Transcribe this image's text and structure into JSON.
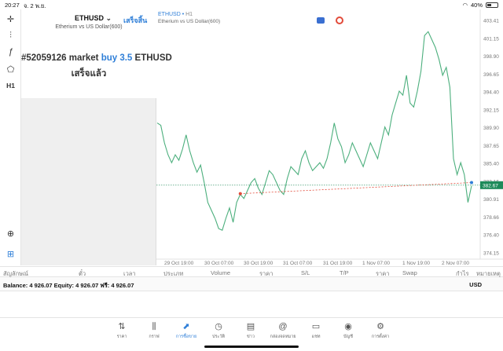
{
  "status": {
    "time": "20:27",
    "date": "จ. 2 พ.ย.",
    "battery": "40%"
  },
  "panel": {
    "symbol": "ETHUSD",
    "done_label": "เสร็จสิ้น",
    "description": "Etherium vs US Dollar(600)",
    "order_prefix": "#52059126 market",
    "order_action": "buy 3.5",
    "order_symbol": "ETHUSD",
    "order_status": "เสร็จแล้ว"
  },
  "chart_header": {
    "symbol": "ETHUSD",
    "timeframe": "H1",
    "subtitle": "Etherium vs US Dollar(600)"
  },
  "left_tools": {
    "timeframe": "H1"
  },
  "chart_data": {
    "type": "line",
    "y_ticks": [
      "403.41",
      "401.15",
      "398.90",
      "396.65",
      "394.40",
      "392.15",
      "389.90",
      "387.65",
      "385.40",
      "383.16",
      "380.91",
      "378.66",
      "376.40",
      "374.15"
    ],
    "x_labels": [
      "29 Oct 19:00",
      "30 Oct 07:00",
      "30 Oct 19:00",
      "31 Oct 07:00",
      "31 Oct 19:00",
      "1 Nov 07:00",
      "1 Nov 19:00",
      "2 Nov 07:00"
    ],
    "current_price": "382.67",
    "ylim": [
      374.15,
      403.41
    ],
    "values": [
      390.5,
      390.2,
      388.0,
      386.5,
      385.5,
      386.5,
      385.8,
      387.2,
      389.0,
      387.0,
      385.5,
      384.3,
      385.2,
      383.0,
      380.5,
      379.5,
      378.5,
      377.2,
      377.0,
      378.5,
      379.8,
      378.0,
      380.5,
      381.5,
      381.0,
      382.0,
      383.0,
      383.5,
      382.3,
      381.5,
      383.0,
      384.5,
      384.0,
      383.0,
      382.0,
      381.5,
      383.5,
      385.0,
      384.5,
      384.0,
      386.0,
      387.0,
      385.5,
      384.5,
      385.0,
      385.5,
      384.8,
      386.0,
      388.0,
      390.5,
      388.5,
      387.5,
      385.5,
      386.5,
      388.0,
      387.0,
      386.0,
      385.0,
      386.5,
      388.0,
      387.0,
      386.0,
      388.0,
      390.0,
      389.0,
      391.5,
      393.0,
      394.5,
      394.0,
      396.5,
      393.0,
      392.5,
      394.5,
      397.0,
      401.5,
      402.0,
      401.0,
      400.0,
      398.5,
      396.5,
      397.5,
      395.0,
      386.0,
      384.0,
      385.5,
      384.0,
      380.5,
      382.6
    ],
    "order": {
      "index": 23,
      "price": 381.6
    }
  },
  "columns": [
    "สัญลักษณ์",
    "ตั๋ว",
    "เวลา",
    "ประเภท",
    "Volume",
    "ราคา",
    "S/L",
    "T/P",
    "ราคา",
    "Swap",
    "กำไร",
    "หมายเหตุ"
  ],
  "balance": {
    "text": "Balance: 4 926.07  Equity: 4 926.07  ฟรี: 4 926.07",
    "currency": "USD"
  },
  "tabs": [
    {
      "label": "ราคา",
      "icon": "quotes-icon"
    },
    {
      "label": "กราฟ",
      "icon": "candles-icon"
    },
    {
      "label": "การซื้อขาย",
      "icon": "trade-icon",
      "active": true
    },
    {
      "label": "ประวัติ",
      "icon": "history-icon"
    },
    {
      "label": "ข่าว",
      "icon": "news-icon"
    },
    {
      "label": "กล่องจดหมาย",
      "icon": "mailbox-icon"
    },
    {
      "label": "แชท",
      "icon": "chat-icon"
    },
    {
      "label": "บัญชี",
      "icon": "account-icon"
    },
    {
      "label": "การตั้งค่า",
      "icon": "settings-icon"
    }
  ],
  "colors": {
    "accent": "#2f7fd8",
    "line": "#4caf7d",
    "order": "#e24b3a",
    "price_label": "#1e8a5a"
  }
}
